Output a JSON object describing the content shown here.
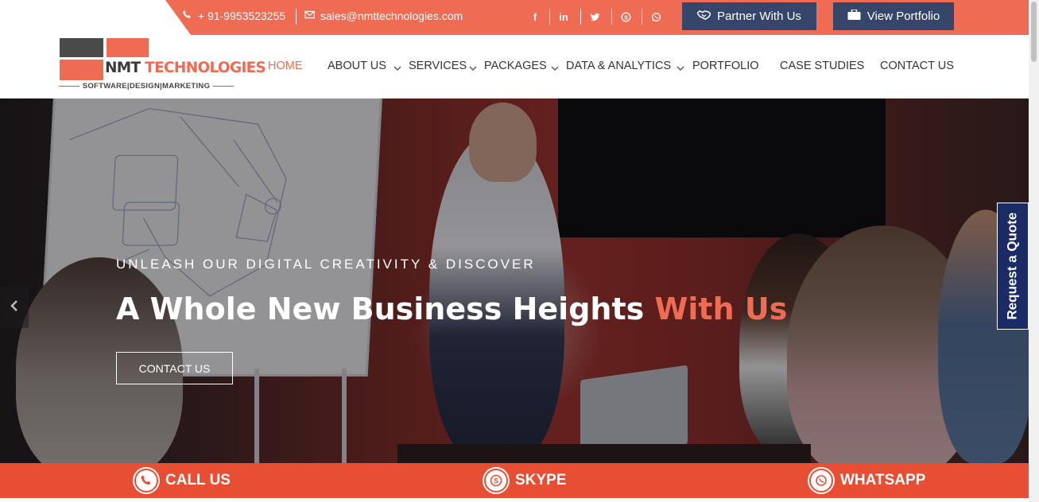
{
  "colors": {
    "accent": "#f06b53",
    "navy": "#36456a",
    "quote_tab": "#1a2b66",
    "bottom_bar": "#e84e34"
  },
  "topbar": {
    "phone": "+ 91-9953523255",
    "email": "sales@nmttechnologies.com",
    "social": [
      {
        "name": "facebook-icon",
        "glyph": "f"
      },
      {
        "name": "linkedin-icon",
        "glyph": "in"
      },
      {
        "name": "twitter-icon",
        "glyph": "twitter"
      },
      {
        "name": "skype-icon",
        "glyph": "skype"
      },
      {
        "name": "whatsapp-icon",
        "glyph": "whatsapp"
      }
    ],
    "partner_label": "Partner With Us",
    "portfolio_label": "View Portfolio"
  },
  "logo": {
    "name_part1": "NMT",
    "name_part2": "TECHNOLOGIES",
    "tagline": "SOFTWARE|DESIGN|MARKETING"
  },
  "nav": {
    "items": [
      {
        "label": "HOME",
        "active": true,
        "dropdown": false
      },
      {
        "label": "ABOUT US",
        "active": false,
        "dropdown": true
      },
      {
        "label": "SERVICES",
        "active": false,
        "dropdown": true
      },
      {
        "label": "PACKAGES",
        "active": false,
        "dropdown": true
      },
      {
        "label": "DATA & ANALYTICS",
        "active": false,
        "dropdown": true
      },
      {
        "label": "PORTFOLIO",
        "active": false,
        "dropdown": false
      },
      {
        "label": "CASE STUDIES",
        "active": false,
        "dropdown": false
      },
      {
        "label": "CONTACT US",
        "active": false,
        "dropdown": false
      }
    ]
  },
  "hero": {
    "eyebrow": "UNLEASH OUR DIGITAL CREATIVITY & DISCOVER",
    "headline_main": "A Whole New Business Heights ",
    "headline_accent": "With Us",
    "cta_label": "CONTACT US",
    "prev_arrow": "chevron-left-icon"
  },
  "quote_tab": {
    "label": "Request a Quote"
  },
  "bottombar": {
    "call_label": "CALL US",
    "skype_label": "SKYPE",
    "whatsapp_label": "WHATSAPP"
  }
}
